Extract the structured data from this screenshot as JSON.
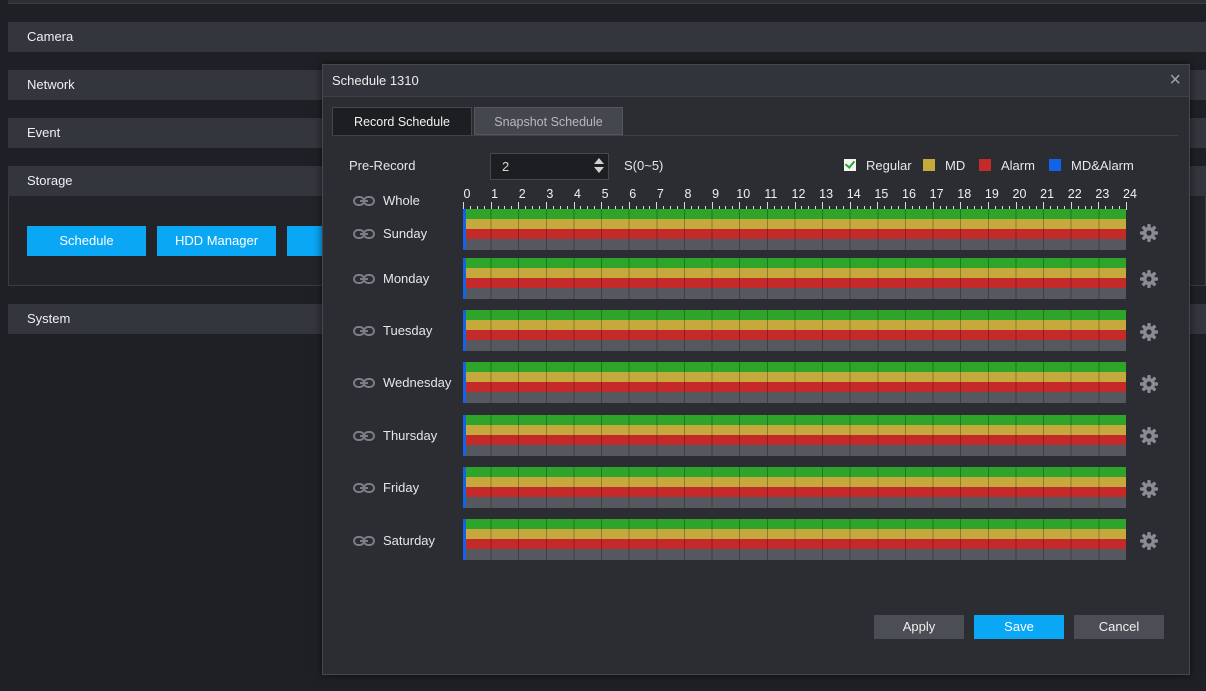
{
  "sidebar": {
    "sections": {
      "camera": "Camera",
      "network": "Network",
      "event": "Event",
      "storage": "Storage",
      "system": "System"
    },
    "storage_buttons": {
      "schedule": "Schedule",
      "hdd_manager": "HDD Manager",
      "third": ""
    }
  },
  "modal": {
    "title": "Schedule 1310",
    "close_glyph": "×",
    "tabs": {
      "record": "Record Schedule",
      "snapshot": "Snapshot Schedule"
    },
    "prerecord": {
      "label": "Pre-Record",
      "value": "2",
      "unit": "S(0~5)"
    },
    "legend": {
      "regular": "Regular",
      "md": "MD",
      "alarm": "Alarm",
      "md_alarm": "MD&Alarm"
    },
    "hours": [
      "0",
      "1",
      "2",
      "3",
      "4",
      "5",
      "6",
      "7",
      "8",
      "9",
      "10",
      "11",
      "12",
      "13",
      "14",
      "15",
      "16",
      "17",
      "18",
      "19",
      "20",
      "21",
      "22",
      "23",
      "24"
    ],
    "days": {
      "whole": "Whole",
      "sunday": "Sunday",
      "monday": "Monday",
      "tuesday": "Tuesday",
      "wednesday": "Wednesday",
      "thursday": "Thursday",
      "friday": "Friday",
      "saturday": "Saturday"
    },
    "schedule_coverage": "00:00-24:00 for Regular, MD and Alarm on every day",
    "buttons": {
      "apply": "Apply",
      "save": "Save",
      "cancel": "Cancel"
    }
  },
  "colors": {
    "regular": "#2ea52a",
    "md": "#c6a93c",
    "alarm": "#c42a2a",
    "md_alarm": "#1164e8",
    "empty": "#56585f",
    "accent": "#0aa7f5"
  },
  "icons": {
    "link": "link-icon",
    "gear": "gear-icon",
    "close": "close-icon",
    "checkbox": "checkbox-checked-icon"
  }
}
